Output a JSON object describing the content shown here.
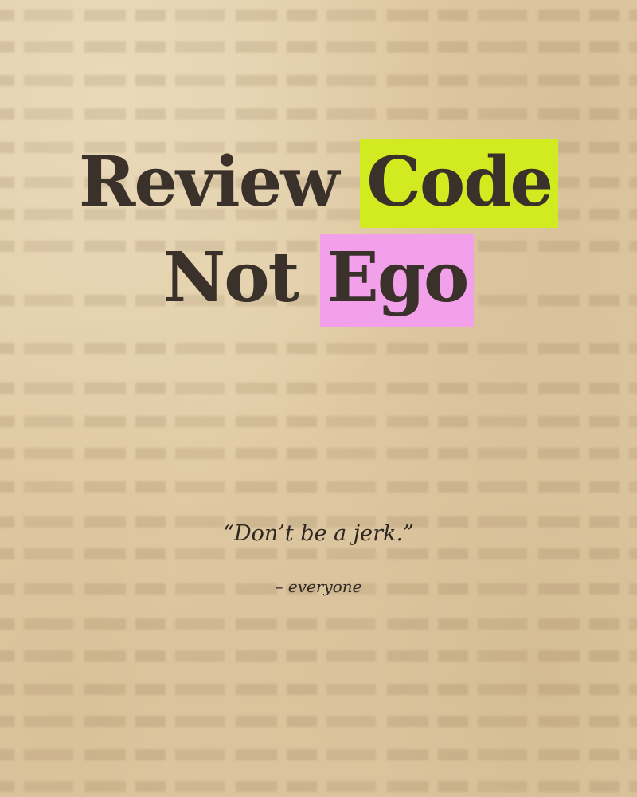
{
  "poster": {
    "title_line_1_plain": "Review",
    "title_line_1_highlight": "Code",
    "title_line_2_plain": "Not",
    "title_line_2_highlight": "Ego",
    "quote": "“Don’t be a jerk.”",
    "attribution": "– everyone"
  },
  "colors": {
    "paper": "#e2cda7",
    "ink": "#3a312a",
    "highlight_green": "#d2ea20",
    "highlight_pink": "#f2a0ea"
  }
}
